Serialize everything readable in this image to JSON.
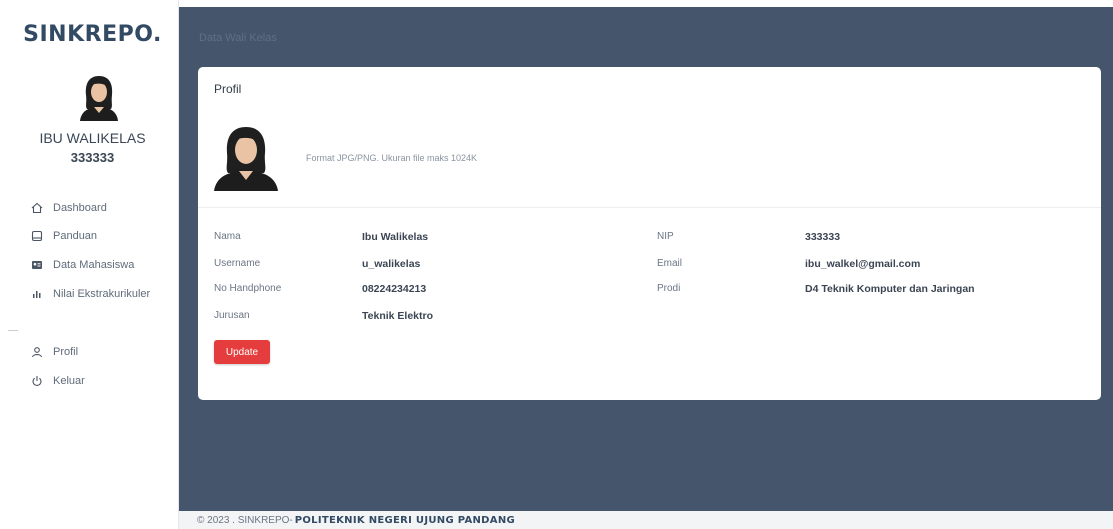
{
  "sidebar": {
    "brand": "SINKREPO.",
    "user_name": "IBU WALIKELAS",
    "user_id": "333333",
    "menu": [
      {
        "label": "Dashboard",
        "icon": "home-icon"
      },
      {
        "label": "Panduan",
        "icon": "book-icon"
      },
      {
        "label": "Data Mahasiswa",
        "icon": "id-card-icon"
      },
      {
        "label": "Nilai Ekstrakurikuler",
        "icon": "bar-chart-icon"
      }
    ],
    "menu_bottom": [
      {
        "label": "Profil",
        "icon": "user-icon"
      },
      {
        "label": "Keluar",
        "icon": "power-icon"
      }
    ]
  },
  "header": {
    "breadcrumb": "Data Wali Kelas"
  },
  "profile": {
    "title": "Profil",
    "photo_note": "Format JPG/PNG. Ukuran file maks 1024K",
    "fields": {
      "nama_label": "Nama",
      "nama_value": "Ibu Walikelas",
      "username_label": "Username",
      "username_value": "u_walikelas",
      "hp_label": "No Handphone",
      "hp_value": "08224234213",
      "jurusan_label": "Jurusan",
      "jurusan_value": "Teknik Elektro",
      "nip_label": "NIP",
      "nip_value": "333333",
      "email_label": "Email",
      "email_value": "ibu_walkel@gmail.com",
      "prodi_label": "Prodi",
      "prodi_value": "D4 Teknik Komputer dan Jaringan"
    },
    "update_label": "Update"
  },
  "footer": {
    "prefix": "© 2023 . SINKREPO-",
    "org": "POLITEKNIK NEGERI UJUNG PANDANG"
  },
  "colors": {
    "main_bg": "#45566c",
    "brand": "#324a63",
    "update_button": "#e53d3d"
  }
}
